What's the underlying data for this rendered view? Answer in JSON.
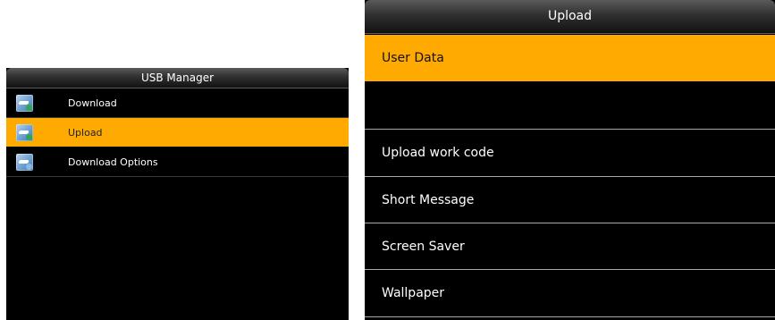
{
  "left_panel": {
    "title": "USB Manager",
    "items": [
      {
        "label": "Download",
        "selected": false,
        "icon": "usb-download-icon",
        "dot_color": "#2fa84f"
      },
      {
        "label": "Upload",
        "selected": true,
        "icon": "usb-upload-icon",
        "dot_color": "#2fa84f"
      },
      {
        "label": "Download Options",
        "selected": false,
        "icon": "usb-options-icon",
        "dot_color": "#8cb8e0"
      }
    ]
  },
  "right_panel": {
    "title": "Upload",
    "items": [
      {
        "label": "User Data",
        "selected": true
      },
      {
        "label": "",
        "selected": false
      },
      {
        "label": "Upload work code",
        "selected": false
      },
      {
        "label": "Short Message",
        "selected": false
      },
      {
        "label": "Screen Saver",
        "selected": false
      },
      {
        "label": "Wallpaper",
        "selected": false
      }
    ]
  },
  "colors": {
    "highlight": "#ffaa00",
    "background": "#000000",
    "text": "#ffffff"
  }
}
